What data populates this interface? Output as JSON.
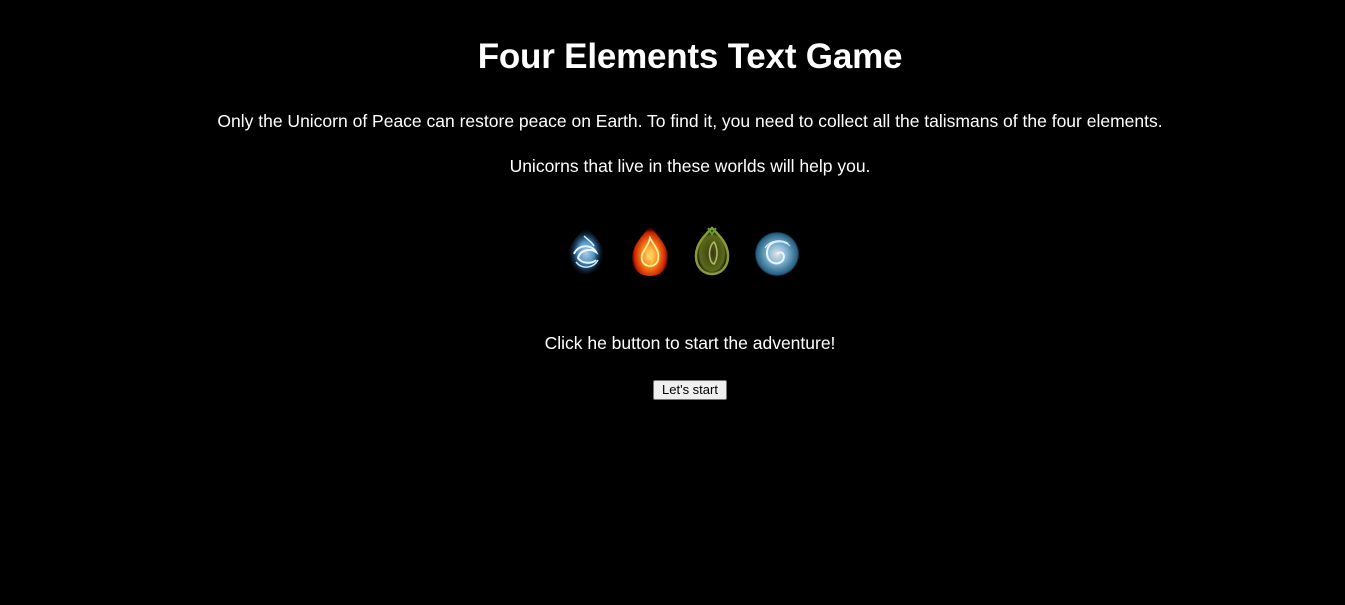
{
  "page": {
    "title": "Four Elements Text Game",
    "intro": "Only the Unicorn of Peace can restore peace on Earth. To find it, you need to collect all the talismans of the four elements.",
    "helper": "Unicorns that live in these worlds will help you.",
    "cta": "Click he button to start the adventure!"
  },
  "elements": [
    {
      "name": "water-element-icon",
      "color": "#7fc4ff"
    },
    {
      "name": "fire-element-icon",
      "color": "#ff5a1a"
    },
    {
      "name": "earth-element-icon",
      "color": "#8a9a3a"
    },
    {
      "name": "air-element-icon",
      "color": "#a8d8f0"
    }
  ],
  "button": {
    "start_label": "Let's start"
  },
  "colors": {
    "background": "#000000",
    "text": "#ffffff"
  }
}
